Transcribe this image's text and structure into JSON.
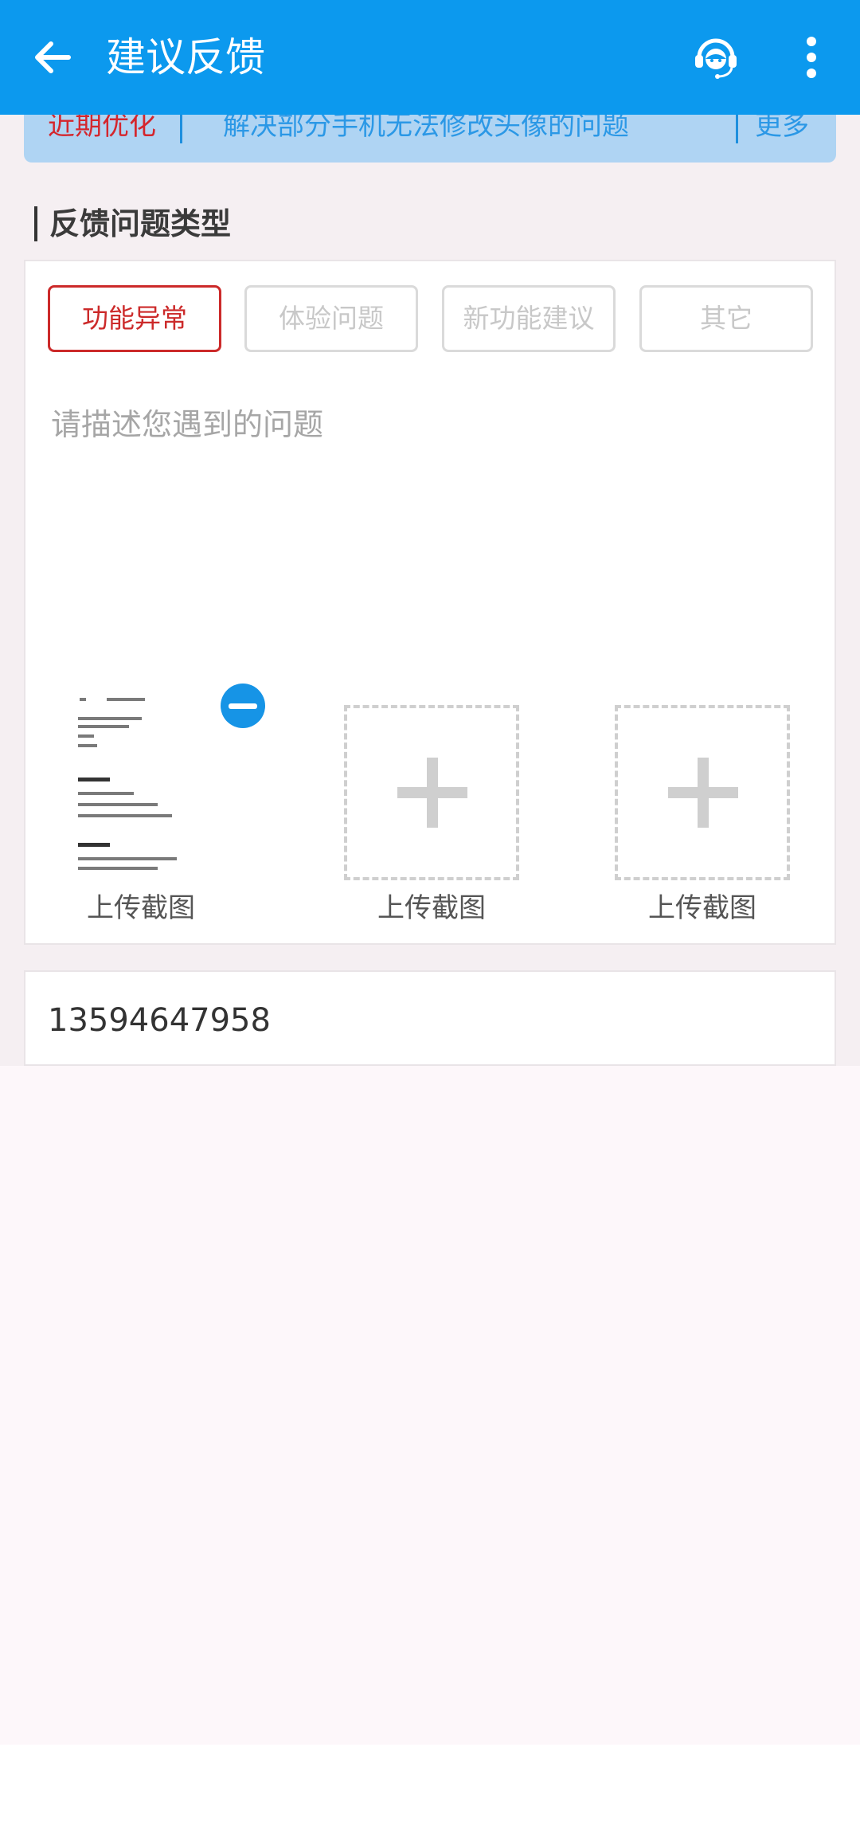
{
  "header": {
    "title": "建议反馈",
    "back_icon": "arrow-left-icon",
    "support_icon": "headset-icon",
    "more_icon": "more-vertical-icon",
    "color": "#0c99ee"
  },
  "notice": {
    "tag": "近期优化",
    "text": "解决部分手机无法修改头像的问题",
    "more": "更多"
  },
  "section": {
    "title": "反馈问题类型"
  },
  "feedback_types": [
    {
      "label": "功能异常",
      "selected": true
    },
    {
      "label": "体验问题",
      "selected": false
    },
    {
      "label": "新功能建议",
      "selected": false
    },
    {
      "label": "其它",
      "selected": false
    }
  ],
  "description": {
    "placeholder": "请描述您遇到的问题"
  },
  "uploads": [
    {
      "label": "上传截图",
      "has_image": true
    },
    {
      "label": "上传截图",
      "has_image": false
    },
    {
      "label": "上传截图",
      "has_image": false
    }
  ],
  "contact": {
    "value": "13594647958"
  }
}
